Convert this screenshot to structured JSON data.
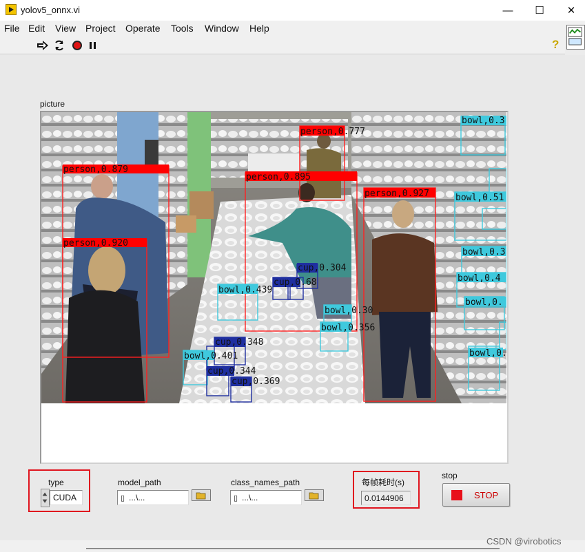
{
  "window": {
    "title": "yolov5_onnx.vi",
    "minimize_glyph": "—",
    "maximize_glyph": "☐",
    "close_glyph": "✕"
  },
  "menu": [
    "File",
    "Edit",
    "View",
    "Project",
    "Operate",
    "Tools",
    "Window",
    "Help"
  ],
  "toolbar": {
    "icons": [
      "run-arrow-icon",
      "run-continuous-icon",
      "abort-icon",
      "pause-icon",
      "context-help-icon"
    ],
    "help_glyph": "?"
  },
  "picture": {
    "label": "picture",
    "detections": [
      {
        "label": "person,0.879",
        "color": "#ff0000"
      },
      {
        "label": "person,0.920",
        "color": "#ff0000"
      },
      {
        "label": "person,0.777",
        "color": "#ff0000"
      },
      {
        "label": "person,0.895",
        "color": "#ff0000"
      },
      {
        "label": "person,0.927",
        "color": "#ff0000"
      },
      {
        "label": "bowl,0.3",
        "color": "#3fc9dd"
      },
      {
        "label": "bowl,0.51",
        "color": "#3fc9dd"
      },
      {
        "label": "bowl,0.3",
        "color": "#3fc9dd"
      },
      {
        "label": "bowl,0.4",
        "color": "#3fc9dd"
      },
      {
        "label": "bowl,0.",
        "color": "#3fc9dd"
      },
      {
        "label": "bowl,0.",
        "color": "#3fc9dd"
      },
      {
        "label": "bowl,0.439",
        "color": "#3fc9dd"
      },
      {
        "label": "bowl,0.30",
        "color": "#3fc9dd"
      },
      {
        "label": "bowl,0.356",
        "color": "#3fc9dd"
      },
      {
        "label": "bowl,0.401",
        "color": "#3fc9dd"
      },
      {
        "label": "cup,0.304",
        "color": "#1f2fa0"
      },
      {
        "label": "cup,0.68",
        "color": "#1f2fa0"
      },
      {
        "label": "cup,0.348",
        "color": "#1f2fa0"
      },
      {
        "label": "cup,0.344",
        "color": "#1f2fa0"
      },
      {
        "label": "cup,0.369",
        "color": "#1f2fa0"
      }
    ]
  },
  "controls": {
    "type": {
      "label": "type",
      "value": "CUDA"
    },
    "model_path": {
      "label": "model_path",
      "value": "...\\..."
    },
    "class_names_path": {
      "label": "class_names_path",
      "value": "...\\..."
    },
    "frame_time": {
      "label": "每帧耗时(s)",
      "value": "0.0144906"
    },
    "stop": {
      "label": "stop",
      "button_text": "STOP"
    }
  },
  "colors": {
    "highlight_box": "#e0141e",
    "stop_red": "#e8101a"
  },
  "watermark": "CSDN @virobotics"
}
